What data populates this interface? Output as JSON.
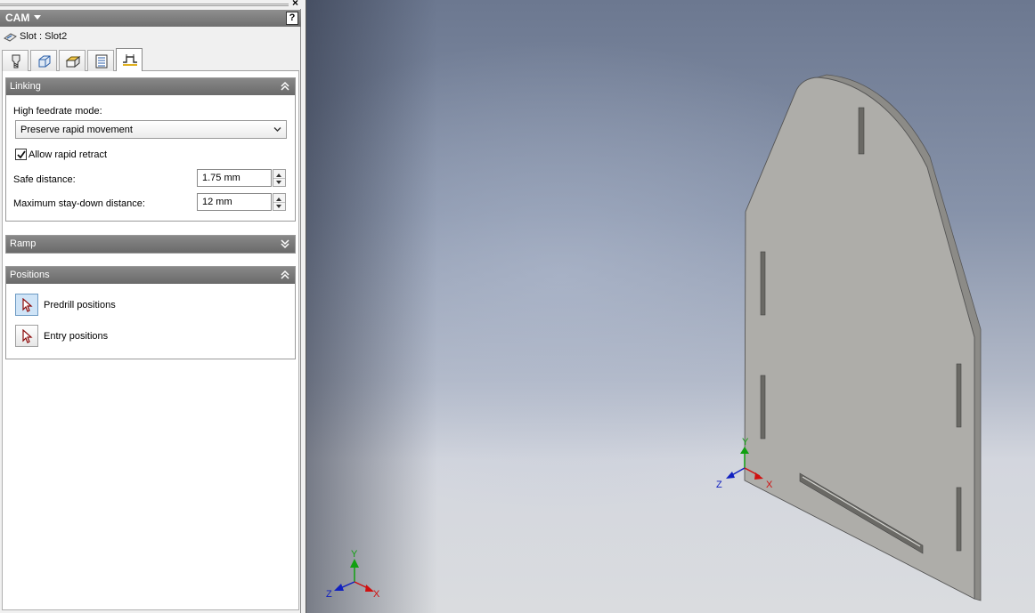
{
  "panel": {
    "title": "CAM",
    "operation_label": "Slot : Slot2",
    "tabs": [
      "tool-tab",
      "geometry-tab",
      "heights-tab",
      "passes-tab",
      "linking-tab"
    ],
    "active_tab": "linking-tab"
  },
  "linking": {
    "header": "Linking",
    "feedrate_label": "High feedrate mode:",
    "feedrate_value": "Preserve rapid movement",
    "allow_rapid_retract_label": "Allow rapid retract",
    "allow_rapid_retract_checked": true,
    "safe_distance_label": "Safe distance:",
    "safe_distance_value": "1.75 mm",
    "max_staydown_label": "Maximum stay-down distance:",
    "max_staydown_value": "12 mm"
  },
  "ramp": {
    "header": "Ramp"
  },
  "positions": {
    "header": "Positions",
    "predrill_label": "Predrill positions",
    "entry_label": "Entry positions"
  },
  "viewport": {
    "model_triad": {
      "x": "X",
      "y": "Y",
      "z": "Z"
    },
    "corner_triad": {
      "x": "X",
      "y": "Y",
      "z": "Z"
    },
    "colors": {
      "x": "#d01010",
      "y": "#11a011",
      "z": "#1020c0"
    }
  }
}
